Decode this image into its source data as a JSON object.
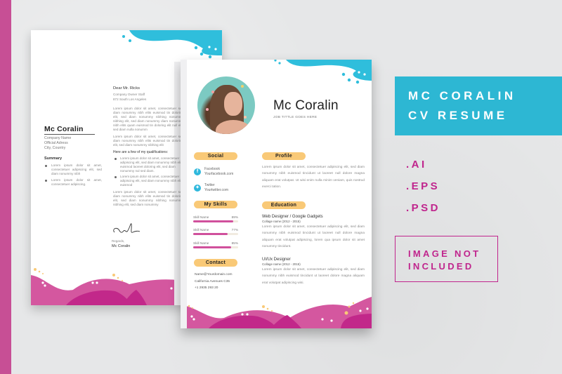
{
  "banner": {
    "title_line1": "MC CORALIN",
    "title_line2": "CV RESUME",
    "bg_color": "#2db7d3"
  },
  "formats": [
    ".AI",
    ".EPS",
    ".PSD"
  ],
  "notice": {
    "line1": "IMAGE NOT",
    "line2": "INCLUDED",
    "color": "#c0258d"
  },
  "colors": {
    "accent_pink": "#d0509c",
    "accent_cyan": "#2fbedc",
    "pill_yellow": "#f9c977"
  },
  "cover_letter": {
    "name": "Mc Coralin",
    "info": [
      "Company Name",
      "Official Adress",
      "City, Country"
    ],
    "summary_heading": "Summary",
    "summary_items": [
      "Lorem ipsum dolor sit amet, consectetuer adipiscing elit, sed diam nonummy nibh",
      "Lorem ipsum dolor sit amet, consectetuer adipiscing."
    ],
    "salutation": "Dear Mr. Ricks",
    "address": [
      "Company Owner Staff",
      "872 South Los Angeles"
    ],
    "paragraphs": [
      "Lorem ipsum dolor sit amet, consectetuer sed diam nonummy nibh elits euismod tin doloring elit, sed diam nonummy nibhing nonummy nibhing elit, sed diam nonummy diam nonummy nibh elits quam euismod tin doloring elit null elit, sed diam nulla nonumm",
      "Lorem ipsum dolor sit amet, consectetuer sed diam nonummy nibh elits euismod tin doloring elit, sed diam nonummy nibhing elit"
    ],
    "qualifications_heading": "Here are a few of my qualifications:",
    "qualifications": [
      "Lorem ipsum dolor sit amet, consectetuer adipiscing elit, sed diam nonummy nibh elits euismod laoreet doloring elit, sed diam nonummy nul sed diam.",
      "Lorem ipsum dolor sit amet, consectetuer adipiscing elit, sed diam nonummy nibh elits euismod"
    ],
    "closing_paragraph": "Lorem ipsum dolor sit amet, consectetuer sed diam nonummy nibh elits euismod tin doloring elit, sed diam nonummy nibhing nonummy nibhing elit, sed diam nonummy",
    "regards": "Regards,",
    "signature_name": "Mc Coralin"
  },
  "resume": {
    "name": "Mc Coralin",
    "job_title": "JOB TITTLE GOES HERE",
    "social": {
      "heading": "Social",
      "items": [
        {
          "icon": "facebook-icon",
          "glyph": "f",
          "label": "Facebook",
          "value": "Yourfacebook.com"
        },
        {
          "icon": "twitter-icon",
          "glyph": "t",
          "label": "Twitter",
          "value": "Yourtwitter.com"
        }
      ]
    },
    "skills": {
      "heading": "My Skills",
      "items": [
        {
          "name": "Skill Name",
          "percent_label": "89%",
          "level": 0.89
        },
        {
          "name": "Skill Name",
          "percent_label": "77%",
          "level": 0.77
        },
        {
          "name": "Skill Name",
          "percent_label": "85%",
          "level": 0.85
        }
      ]
    },
    "contact": {
      "heading": "Contact",
      "lines": [
        "Name@Yourdomain.com",
        "California Avenues C35",
        "+1 2935 293 20"
      ]
    },
    "profile": {
      "heading": "Profile",
      "text": "Lorem ipsum dolor sit amet, consectetuer adipiscing elit, sed diam nonummy nibh euismod tincidunt ut laoreet null dolore magna aliquam erat volutpat. Ut wisi enim nulla minim veniam, quis nostrud exerci tation."
    },
    "education": {
      "heading": "Education",
      "items": [
        {
          "title": "Web Designer / Google Gadgets",
          "college": "Collage name (2012 - 2015)",
          "text": "Lorem ipsum dolor sit amet, consectetuer adipiscing elit, sed diam nonummy nibh euismod tincidunt ut laoreet null dolore magna aliquam erat volutpat adipiscing, lorem qua ipsum dolor sit amet nonummy tincidunt."
        },
        {
          "title": "UI/Ux Designer",
          "college": "Collage name (2012 - 2015)",
          "text": "Lorem ipsum dolor sit amet, consectetuer adipiscing elit, sed diam nonummy nibh euismod tincidunt ut laoreet dolore magna aliquam erat volutpat adipiscing wisi."
        }
      ]
    }
  }
}
